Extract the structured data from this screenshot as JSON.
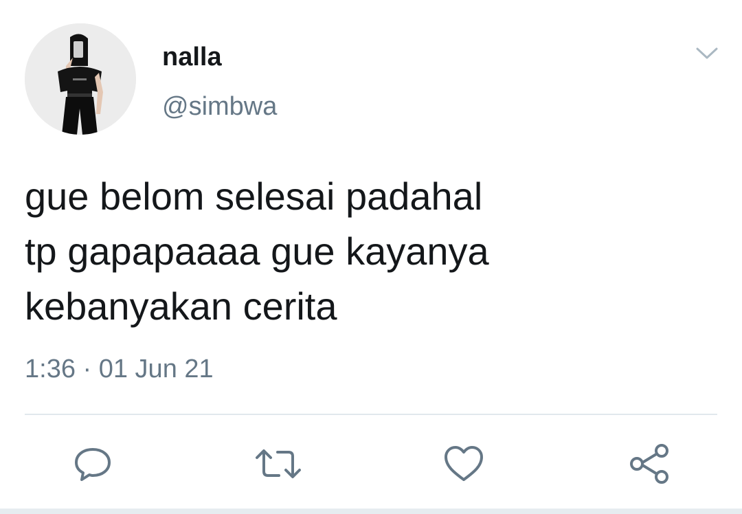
{
  "tweet": {
    "author": {
      "display_name": "nalla",
      "handle": "@simbwa"
    },
    "text_lines": [
      "gue belom selesai padahal",
      "tp gapapaaaa gue kayanya",
      "kebanyakan cerita"
    ],
    "timestamp": "1:36 · 01 Jun 21"
  },
  "actions": {
    "reply": "reply-icon",
    "retweet": "retweet-icon",
    "like": "heart-icon",
    "share": "share-icon"
  },
  "colors": {
    "text_primary": "#14171a",
    "text_secondary": "#657786",
    "icon": "#657786",
    "divider": "#e1e8ed"
  }
}
